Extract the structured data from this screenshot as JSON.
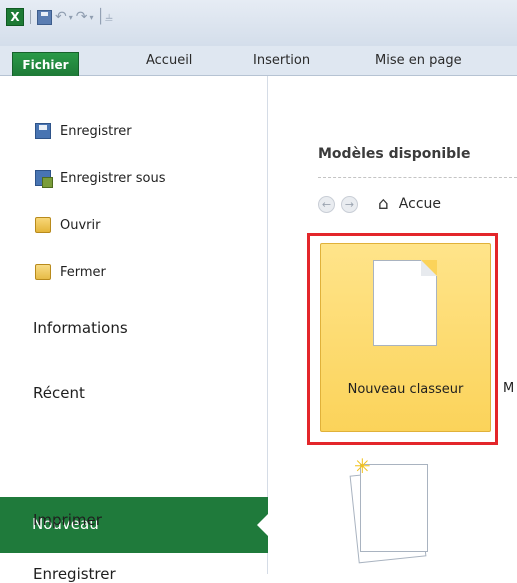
{
  "titlebar": {
    "app_icon": "excel-icon",
    "app_letter": "X",
    "qat_undo": "↶",
    "qat_redo": "↷",
    "qat_dropdown": "▾",
    "qat_customize": "│⫨"
  },
  "ribbon": {
    "tabs": [
      "Fichier",
      "Accueil",
      "Insertion",
      "Mise en page"
    ]
  },
  "nav": {
    "commands": [
      {
        "label": "Enregistrer",
        "icon": "save-icon"
      },
      {
        "label": "Enregistrer sous",
        "icon": "save-as-icon"
      },
      {
        "label": "Ouvrir",
        "icon": "open-folder-icon"
      },
      {
        "label": "Fermer",
        "icon": "close-folder-icon"
      }
    ],
    "items": [
      "Informations",
      "Récent",
      "Nouveau",
      "Imprimer",
      "Enregistrer"
    ],
    "active": "Nouveau"
  },
  "main": {
    "section_title": "Modèles disponible",
    "breadcrumb": "Accue",
    "back_glyph": "←",
    "forward_glyph": "→",
    "home_glyph": "⌂",
    "tiles": [
      {
        "label": "Nouveau classeur",
        "selected": true
      },
      {
        "label": "M"
      }
    ],
    "star_glyph": "✳",
    "highlight_color": "#e3262a"
  },
  "colors": {
    "file_tab": "#1e7a37",
    "nav_active": "#1f7a3b",
    "tile_selected": "#fbd35a"
  }
}
